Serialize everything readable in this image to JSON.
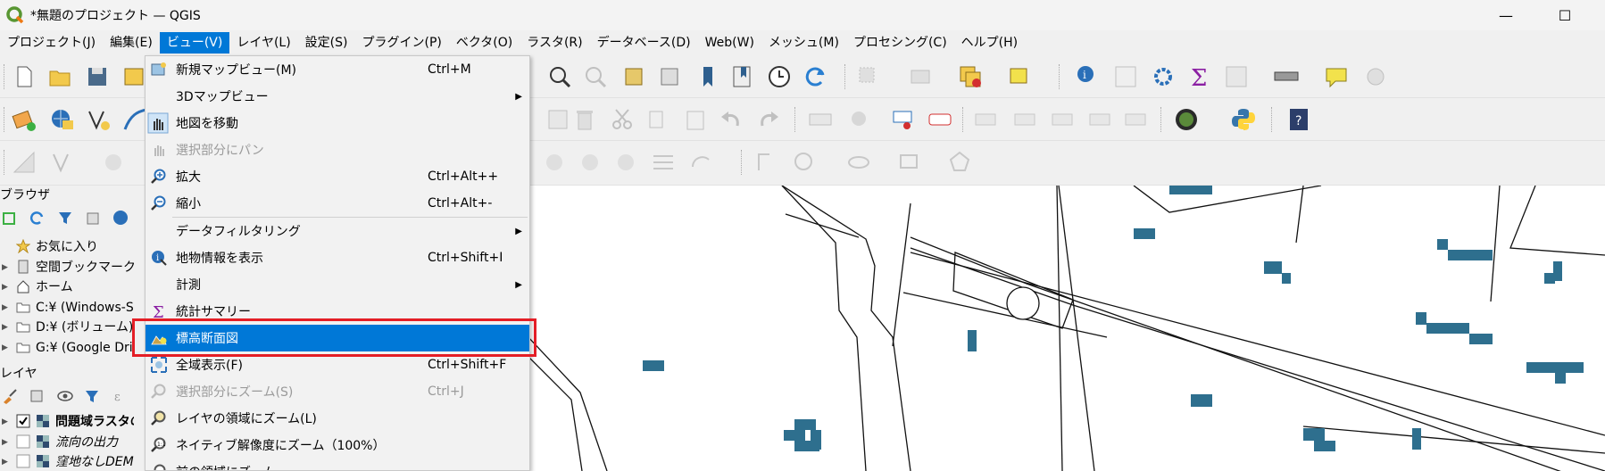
{
  "window": {
    "title": "*無題のプロジェクト — QGIS",
    "minimize_glyph": "—",
    "maximize_glyph": "☐"
  },
  "menubar": {
    "items": [
      {
        "label": "プロジェクト(J)"
      },
      {
        "label": "編集(E)"
      },
      {
        "label": "ビュー(V)",
        "active": true
      },
      {
        "label": "レイヤ(L)"
      },
      {
        "label": "設定(S)"
      },
      {
        "label": "プラグイン(P)"
      },
      {
        "label": "ベクタ(O)"
      },
      {
        "label": "ラスタ(R)"
      },
      {
        "label": "データベース(D)"
      },
      {
        "label": "Web(W)"
      },
      {
        "label": "メッシュ(M)"
      },
      {
        "label": "プロセシング(C)"
      },
      {
        "label": "ヘルプ(H)"
      }
    ]
  },
  "view_menu": {
    "items": [
      {
        "label": "新規マップビュー(M)",
        "shortcut": "Ctrl+M",
        "icon": "new-map-view-icon"
      },
      {
        "label": "3Dマップビュー",
        "submenu": true,
        "icon": ""
      },
      {
        "label": "地図を移動",
        "icon": "pan-hand-icon"
      },
      {
        "label": "選択部分にパン",
        "disabled": true,
        "icon": "pan-to-selection-icon"
      },
      {
        "label": "拡大",
        "shortcut": "Ctrl+Alt++",
        "icon": "zoom-in-icon"
      },
      {
        "label": "縮小",
        "shortcut": "Ctrl+Alt+-",
        "icon": "zoom-out-icon"
      },
      {
        "label": "データフィルタリング",
        "submenu": true,
        "icon": ""
      },
      {
        "label": "地物情報を表示",
        "shortcut": "Ctrl+Shift+I",
        "icon": "identify-icon"
      },
      {
        "label": "計測",
        "submenu": true,
        "icon": ""
      },
      {
        "label": "統計サマリー",
        "icon": "sigma-icon"
      },
      {
        "label": "標高断面図",
        "highlight": true,
        "icon": "elevation-profile-icon"
      },
      {
        "label": "全域表示(F)",
        "shortcut": "Ctrl+Shift+F",
        "icon": "zoom-full-icon"
      },
      {
        "label": "選択部分にズーム(S)",
        "shortcut": "Ctrl+J",
        "disabled": true,
        "icon": "zoom-to-selection-icon"
      },
      {
        "label": "レイヤの領域にズーム(L)",
        "icon": "zoom-to-layer-icon"
      },
      {
        "label": "ネイティブ解像度にズーム（100%）",
        "icon": "zoom-native-icon"
      },
      {
        "label": "前の領域にズーム",
        "icon": "zoom-last-icon"
      }
    ]
  },
  "browser_panel": {
    "title": "ブラウザ",
    "items": [
      {
        "label": "お気に入り",
        "icon": "star-icon"
      },
      {
        "label": "空間ブックマーク",
        "icon": "bookmark-icon"
      },
      {
        "label": "ホーム",
        "icon": "home-icon"
      },
      {
        "label": "C:¥ (Windows-SSD)",
        "icon": "folder-icon"
      },
      {
        "label": "D:¥ (ボリューム)",
        "icon": "folder-icon"
      },
      {
        "label": "G:¥ (Google Drive)",
        "icon": "folder-icon"
      }
    ]
  },
  "layers_panel": {
    "title": "レイヤ",
    "items": [
      {
        "label": "問題域ラスタの",
        "checked": true,
        "bold": true
      },
      {
        "label": "流向の出力",
        "checked": false,
        "italic": true
      },
      {
        "label": "窪地なしDEM",
        "checked": false,
        "italic": true
      }
    ]
  },
  "colors": {
    "accent": "#0078d7",
    "highlight_border": "#e41e26",
    "raster_cells": "#2e6f8e"
  }
}
